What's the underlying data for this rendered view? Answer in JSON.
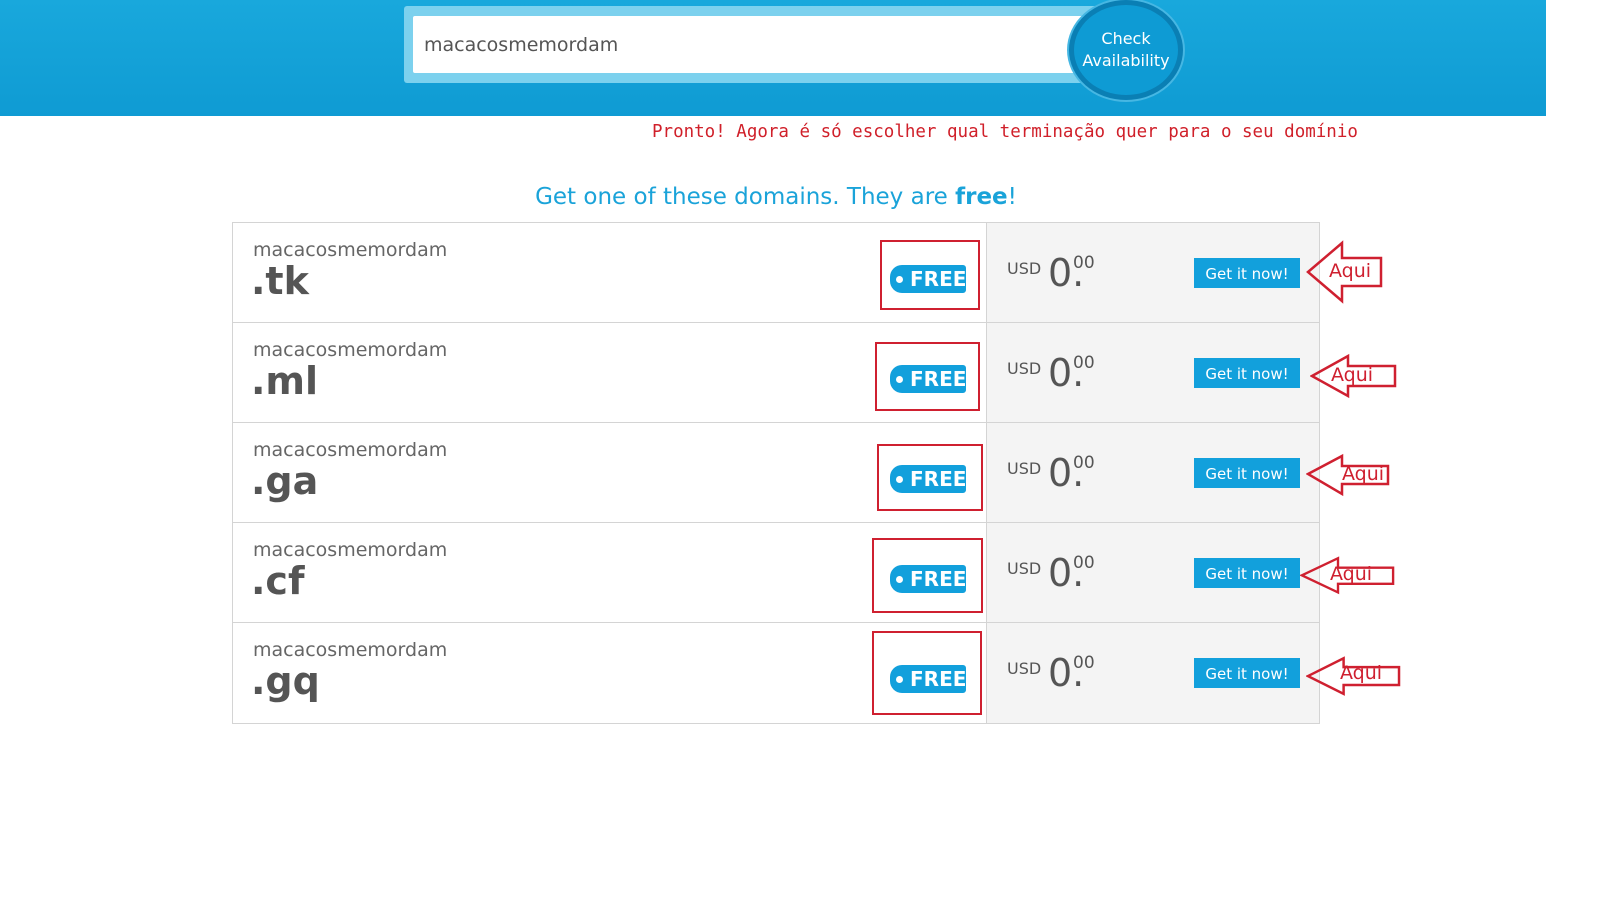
{
  "search": {
    "value": "macacosmemordam",
    "button_label": "Check Availability"
  },
  "notice": "Pronto! Agora é só escolher qual terminação quer para o seu domínio",
  "headline": {
    "text": "Get one of these domains. They are ",
    "emphasis": "free",
    "suffix": "!"
  },
  "domains": [
    {
      "name": "macacosmemordam",
      "tld": ".tk",
      "badge": "FREE",
      "currency": "USD",
      "price_whole": "0.",
      "price_cents": "00",
      "button": "Get it now!",
      "annotation": "Aqui"
    },
    {
      "name": "macacosmemordam",
      "tld": ".ml",
      "badge": "FREE",
      "currency": "USD",
      "price_whole": "0.",
      "price_cents": "00",
      "button": "Get it now!",
      "annotation": "Aqui"
    },
    {
      "name": "macacosmemordam",
      "tld": ".ga",
      "badge": "FREE",
      "currency": "USD",
      "price_whole": "0.",
      "price_cents": "00",
      "button": "Get it now!",
      "annotation": "Aqui"
    },
    {
      "name": "macacosmemordam",
      "tld": ".cf",
      "badge": "FREE",
      "currency": "USD",
      "price_whole": "0.",
      "price_cents": "00",
      "button": "Get it now!",
      "annotation": "Aqui"
    },
    {
      "name": "macacosmemordam",
      "tld": ".gq",
      "badge": "FREE",
      "currency": "USD",
      "price_whole": "0.",
      "price_cents": "00",
      "button": "Get it now!",
      "annotation": "Aqui"
    }
  ],
  "colors": {
    "brand_blue": "#12a0dc",
    "annotation_red": "#cf2030"
  }
}
